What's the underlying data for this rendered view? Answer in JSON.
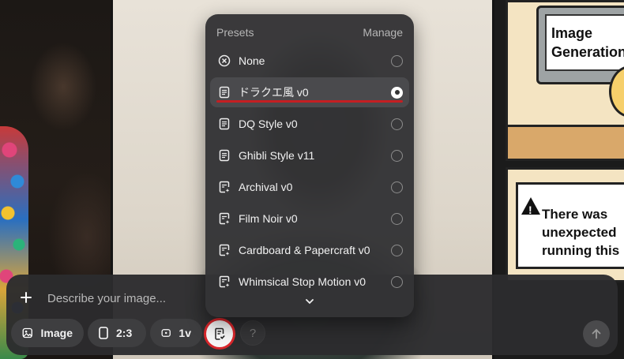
{
  "background": {
    "comic_monitor_text": "Image Generation",
    "comic_sign_text": "There was unexpected running this re"
  },
  "presets_menu": {
    "title": "Presets",
    "manage_label": "Manage",
    "items": [
      {
        "label": "None",
        "icon": "none-circle-x-icon",
        "selected": false
      },
      {
        "label": "ドラクエ風 v0",
        "icon": "document-icon",
        "selected": true
      },
      {
        "label": "DQ Style v0",
        "icon": "document-icon",
        "selected": false
      },
      {
        "label": "Ghibli Style v11",
        "icon": "document-icon",
        "selected": false
      },
      {
        "label": "Archival v0",
        "icon": "document-sparkle-icon",
        "selected": false
      },
      {
        "label": "Film Noir v0",
        "icon": "document-sparkle-icon",
        "selected": false
      },
      {
        "label": "Cardboard & Papercraft v0",
        "icon": "document-sparkle-icon",
        "selected": false
      },
      {
        "label": "Whimsical Stop Motion v0",
        "icon": "document-sparkle-icon",
        "selected": false
      }
    ],
    "more_icon": "chevron-down-icon"
  },
  "composer": {
    "add_icon": "plus-icon",
    "input_placeholder": "Describe your image...",
    "input_value": "",
    "chips": {
      "image_label": "Image",
      "ratio_label": "2:3",
      "version_label": "1v"
    },
    "preset_icon": "document-check-icon",
    "help_label": "?",
    "send_icon": "arrow-up-icon"
  },
  "colors": {
    "highlight_ring": "#d8262b",
    "menu_bg": "#343436",
    "composer_bg": "#2c2c2e"
  }
}
